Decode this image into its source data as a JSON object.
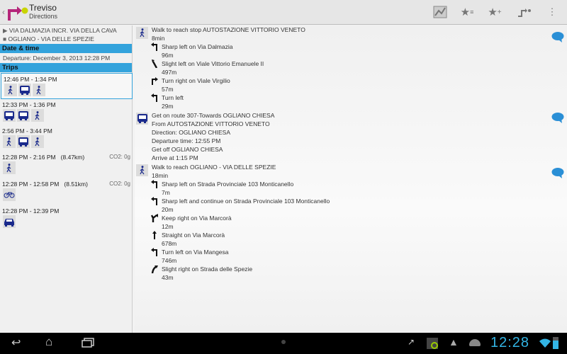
{
  "header": {
    "title": "Treviso",
    "subtitle": "Directions",
    "actions": [
      "map-icon",
      "favorites-list-icon",
      "add-favorite-icon",
      "route-icon",
      "overflow-menu-icon"
    ]
  },
  "left": {
    "origin": "VIA DALMAZIA INCR. VIA DELLA CAVA",
    "destination": "OGLIANO - VIA DELLE SPEZIE",
    "date_time_label": "Date & time",
    "departure": "Departure: December 3, 2013 12:28 PM",
    "trips_label": "Trips",
    "trips": [
      {
        "time": "12:46 PM - 1:34 PM",
        "co2": "",
        "modes": [
          "walk",
          "bus",
          "walk"
        ]
      },
      {
        "time": "12:33 PM - 1:36 PM",
        "co2": "",
        "modes": [
          "bus",
          "bus",
          "walk"
        ]
      },
      {
        "time": "2:56 PM - 3:44 PM",
        "co2": "",
        "modes": [
          "walk",
          "bus",
          "walk"
        ]
      },
      {
        "time": "12:28 PM - 2:16 PM   (8.47km)",
        "co2": "CO2: 0g",
        "modes": [
          "walk"
        ]
      },
      {
        "time": "12:28 PM - 12:58 PM   (8.51km)",
        "co2": "CO2: 0g",
        "modes": [
          "bike"
        ]
      },
      {
        "time": "12:28 PM - 12:39 PM",
        "co2": "",
        "modes": [
          "car"
        ]
      }
    ]
  },
  "segments": [
    {
      "mode": "walk",
      "lines": [
        "Walk to reach stop AUTOSTAZIONE VITTORIO VENETO",
        "8min"
      ],
      "steps": [
        {
          "turn": "sharp-left",
          "text": "Sharp left on Via Dalmazia",
          "dist": "96m"
        },
        {
          "turn": "slight-left",
          "text": "Slight left on Viale Vittorio Emanuele II",
          "dist": "497m"
        },
        {
          "turn": "right",
          "text": "Turn right on Viale Virgilio",
          "dist": "57m"
        },
        {
          "turn": "left",
          "text": "Turn left",
          "dist": "29m"
        }
      ]
    },
    {
      "mode": "bus",
      "lines": [
        "Get on route 307-Towards OGLIANO CHIESA",
        "From AUTOSTAZIONE VITTORIO VENETO",
        "Direction: OGLIANO CHIESA",
        "Departure time: 12:55 PM",
        "Get off OGLIANO CHIESA",
        "Arrive at 1:15 PM"
      ],
      "steps": []
    },
    {
      "mode": "walk",
      "lines": [
        "Walk to reach OGLIANO - VIA DELLE SPEZIE",
        "18min"
      ],
      "steps": [
        {
          "turn": "sharp-left",
          "text": "Sharp left on Strada Provinciale 103 Monticanello",
          "dist": "7m"
        },
        {
          "turn": "sharp-left",
          "text": "Sharp left and continue on Strada Provinciale 103 Monticanello",
          "dist": "20m"
        },
        {
          "turn": "keep-right",
          "text": "Keep right on Via Marcorà",
          "dist": "12m"
        },
        {
          "turn": "straight",
          "text": "Straight on Via Marcorà",
          "dist": "678m"
        },
        {
          "turn": "left",
          "text": "Turn left on Via Mangesa",
          "dist": "746m"
        },
        {
          "turn": "slight-right",
          "text": "Slight right on Strada delle Spezie",
          "dist": "43m"
        }
      ]
    }
  ],
  "status": {
    "time": "12:28"
  },
  "colors": {
    "accent": "#33a3dc",
    "icon": "#1a2a8c",
    "clock": "#33b5e5"
  }
}
